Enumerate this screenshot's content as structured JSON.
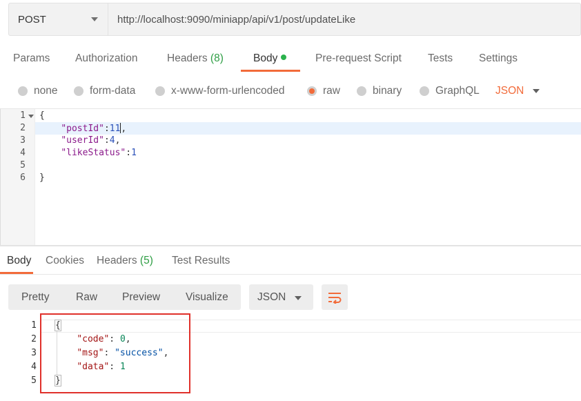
{
  "request": {
    "method": "POST",
    "url": "http://localhost:9090/miniapp/api/v1/post/updateLike"
  },
  "request_tabs": {
    "params": "Params",
    "authorization": "Authorization",
    "headers": "Headers",
    "headers_count": "(8)",
    "body": "Body",
    "pre_request": "Pre-request Script",
    "tests": "Tests",
    "settings": "Settings"
  },
  "body_options": {
    "none": "none",
    "form_data": "form-data",
    "urlencoded": "x-www-form-urlencoded",
    "raw": "raw",
    "binary": "binary",
    "graphql": "GraphQL",
    "format": "JSON",
    "selected": "raw"
  },
  "request_body": {
    "line_numbers": [
      "1",
      "2",
      "3",
      "4",
      "5",
      "6"
    ],
    "open": "{",
    "close": "}",
    "fields": [
      {
        "key": "\"postId\"",
        "value": "11"
      },
      {
        "key": "\"userId\"",
        "value": "4"
      },
      {
        "key": "\"likeStatus\"",
        "value": "1"
      }
    ]
  },
  "response_tabs": {
    "body": "Body",
    "cookies": "Cookies",
    "headers": "Headers",
    "headers_count": "(5)",
    "test_results": "Test Results"
  },
  "response_toolbar": {
    "pretty": "Pretty",
    "raw": "Raw",
    "preview": "Preview",
    "visualize": "Visualize",
    "format": "JSON"
  },
  "response_body": {
    "line_numbers": [
      "1",
      "2",
      "3",
      "4",
      "5"
    ],
    "open": "{",
    "close": "}",
    "fields": [
      {
        "key": "\"code\"",
        "value": "0"
      },
      {
        "key": "\"msg\"",
        "value": "\"success\""
      },
      {
        "key": "\"data\"",
        "value": "1"
      }
    ]
  },
  "colors": {
    "accent": "#f26b3a",
    "count_green": "#2e9e44",
    "highlight_box": "#e0302a"
  }
}
